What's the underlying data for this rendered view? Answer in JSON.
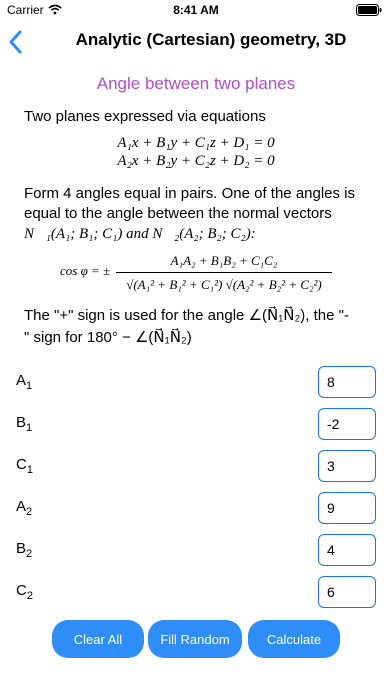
{
  "status_bar": {
    "carrier": "Carrier",
    "time": "8:41 AM"
  },
  "nav": {
    "title": "Analytic (Cartesian) geometry, 3D",
    "back_icon": "chevron-left-icon"
  },
  "section_title": "Angle between two planes",
  "intro_text": "Two planes expressed via equations",
  "equations": [
    "A₁x + B₁y + C₁z + D₁ = 0",
    "A₂x + B₂y + C₂z + D₂ = 0"
  ],
  "paragraph": "Form 4 angles equal in pairs. One of the angles is equal to the angle between the normal vectors",
  "vectors_text": "N⃗₁(A₁; B₁; C₁) and N⃗₂(A₂; B₂; C₂):",
  "formula": {
    "lhs": "cos φ = ±",
    "numerator": "A₁A₂ + B₁B₂ + C₁C₂",
    "denominator": "√(A₁² + B₁² + C₁²) √(A₂² + B₂² + C₂²)"
  },
  "sign_note_line1": "The \"+\" sign is used for the angle ∠(N⃗₁N⃗₂), the \"-",
  "sign_note_line2": "\" sign for 180° − ∠(N⃗₁N⃗₂)",
  "fields": [
    {
      "label": "A",
      "sub": "1",
      "value": "8"
    },
    {
      "label": "B",
      "sub": "1",
      "value": "-2"
    },
    {
      "label": "C",
      "sub": "1",
      "value": "3"
    },
    {
      "label": "A",
      "sub": "2",
      "value": "9"
    },
    {
      "label": "B",
      "sub": "2",
      "value": "4"
    },
    {
      "label": "C",
      "sub": "2",
      "value": "6"
    }
  ],
  "buttons": {
    "clear": "Clear All",
    "fill": "Fill Random",
    "calculate": "Calculate"
  },
  "colors": {
    "accent": "#2e8df7",
    "title": "#b14fc5",
    "field_border": "#1a73e8"
  }
}
